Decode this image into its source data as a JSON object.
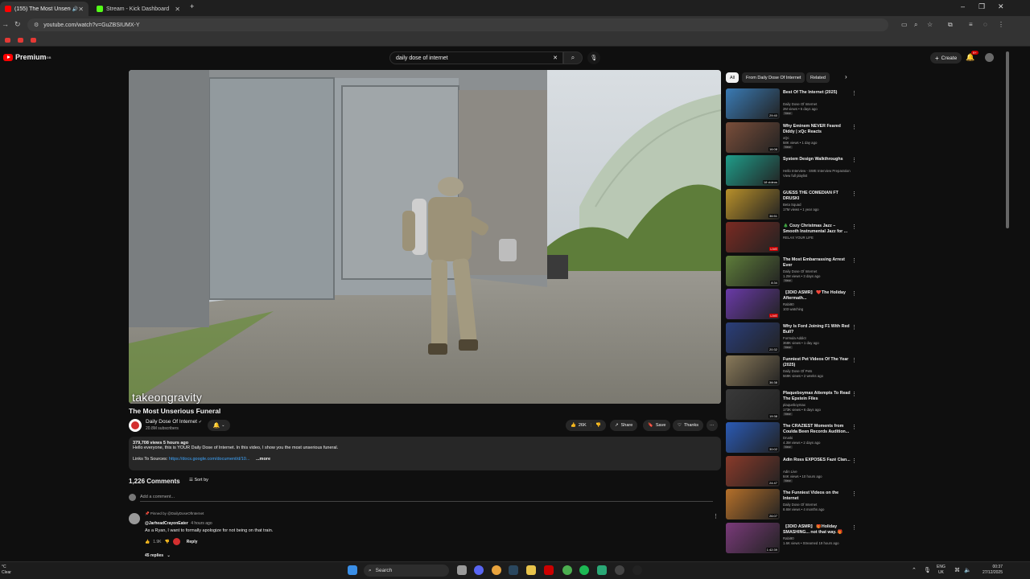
{
  "browser": {
    "tabs": [
      {
        "label": "(155) The Most Unserious F",
        "active": true
      },
      {
        "label": "Stream - Kick Dashboard",
        "active": false
      }
    ],
    "new_tab": "+",
    "url": "youtube.com/watch?v=GuZBSIUMX-Y",
    "window_controls": [
      "–",
      "❐",
      "✕"
    ]
  },
  "header": {
    "logo_text": "Premium",
    "logo_sup": "GB",
    "search_value": "daily dose of internet",
    "clear": "✕",
    "create_label": "Create",
    "notification_count": "9+"
  },
  "player": {
    "watermark": "takeongravity"
  },
  "video": {
    "title": "The Most Unserious Funeral",
    "channel": "Daily Dose Of Internet",
    "verified": "✔",
    "subscribers": "20.8M subscribers",
    "likes": "26K",
    "share_label": "Share",
    "save_label": "Save",
    "thanks_label": "Thanks",
    "more_dots": "···"
  },
  "description": {
    "meta": "379,708 views  5 hours ago",
    "text": "Hello everyone, this is YOUR Daily Dose of Internet. In this video, I show you the most unserious funeral.",
    "links_label": "Links To Sources:",
    "link": "https://docs.google.com/document/d/10...",
    "more": "...more"
  },
  "comments": {
    "count": "1,226 Comments",
    "sort_label": "Sort by",
    "add_placeholder": "Add a comment...",
    "pinned": {
      "pinned_by": "Pinned by @DailyDoseOfInternet",
      "author": "@JarheadCrayonEater",
      "time": "4 hours ago",
      "text": "As a Ryan, I want to formally apologize for not being on that train.",
      "likes": "1.9K",
      "reply_label": "Reply",
      "replies": "45 replies"
    }
  },
  "sidebar": {
    "chips": [
      "All",
      "From Daily Dose Of Internet",
      "Related"
    ],
    "videos": [
      {
        "title": "Best Of The Internet (2025)",
        "channel": "Daily Dose Of Internet",
        "meta": "2M views • 5 days ago",
        "badge": "New",
        "duration": "29:40",
        "color": "#3a7bb5"
      },
      {
        "title": "Why Eminem NEVER Feared Diddy | xQc Reacts",
        "channel": "xQc",
        "meta": "58K views • 1 day ago",
        "badge": "New",
        "duration": "16:08",
        "color": "#7a4e3a"
      },
      {
        "title": "System Design Walkthroughs",
        "channel": "Hello Interview - SWE Interview Preparation",
        "meta": "View full playlist",
        "badge": "",
        "duration": "18 videos",
        "color": "#1f9d8a"
      },
      {
        "title": "GUESS THE COMEDIAN FT DRUSKI",
        "channel": "Beta Squad",
        "meta": "17M views • 1 year ago",
        "badge": "",
        "duration": "36:51",
        "color": "#b8902a"
      },
      {
        "title": "🎄 Cozy Christmas Jazz – Smooth Instrumental Jazz for ...",
        "channel": "RELAX YOUR LIFE",
        "meta": "",
        "badge": "",
        "duration": "LIVE",
        "color": "#7a2a22",
        "live": true
      },
      {
        "title": "The Most Embarrassing Arrest Ever",
        "channel": "Daily Dose Of Internet",
        "meta": "1.2M views • 3 days ago",
        "badge": "New",
        "duration": "8:34",
        "color": "#5e7d3a"
      },
      {
        "title": "【3DIO ASMR】 ❤️The Holiday Aftermath...",
        "channel": "Rabi90",
        "meta": "103 watching",
        "badge": "",
        "duration": "LIVE",
        "color": "#6a3aa8",
        "live": true
      },
      {
        "title": "Why Is Ford Joining F1 With Red Bull?",
        "channel": "Formula Addict",
        "meta": "368K views • 1 day ago",
        "badge": "New",
        "duration": "20:32",
        "color": "#2a3e7a"
      },
      {
        "title": "Funniest Pet Videos Of The Year (2025)",
        "channel": "Daily Dose Of Pets",
        "meta": "569K views • 2 weeks ago",
        "badge": "",
        "duration": "36:38",
        "color": "#8a7a5a"
      },
      {
        "title": "Plaqueboymax Attempts To Read The Epstein Files",
        "channel": "plaqueboymax",
        "meta": "173K views • 6 days ago",
        "badge": "New",
        "duration": "19:38",
        "color": "#3a3a3a"
      },
      {
        "title": "The CRAZIEST Moments from Coulda Been Records Audition...",
        "channel": "Druski",
        "meta": "4.3M views • 2 days ago",
        "badge": "New",
        "duration": "30:02",
        "color": "#2a5ab5"
      },
      {
        "title": "Adin Ross EXPOSES Fazé Clan...",
        "channel": "Adin Live",
        "meta": "84K views • 10 hours ago",
        "badge": "New",
        "duration": "24:47",
        "color": "#8a3a2a"
      },
      {
        "title": "The Funniest Videos on the Internet",
        "channel": "Daily Dose Of Internet",
        "meta": "8.6M views • 4 months ago",
        "badge": "",
        "duration": "26:07",
        "color": "#b5702a"
      },
      {
        "title": "【3DIO ASMR】 🎁Holiday SMASHING... not that way. 🎁",
        "channel": "Rabi90",
        "meta": "1.6K views • Streamed 19 hours ago",
        "badge": "",
        "duration": "1:42:39",
        "color": "#7a3a7a"
      }
    ]
  },
  "taskbar": {
    "weather_temp": "°C",
    "weather_desc": "Clear",
    "search_label": "Search",
    "lang_top": "ENG",
    "lang_bottom": "UK",
    "time": "00:37",
    "date": "27/12/2025"
  }
}
